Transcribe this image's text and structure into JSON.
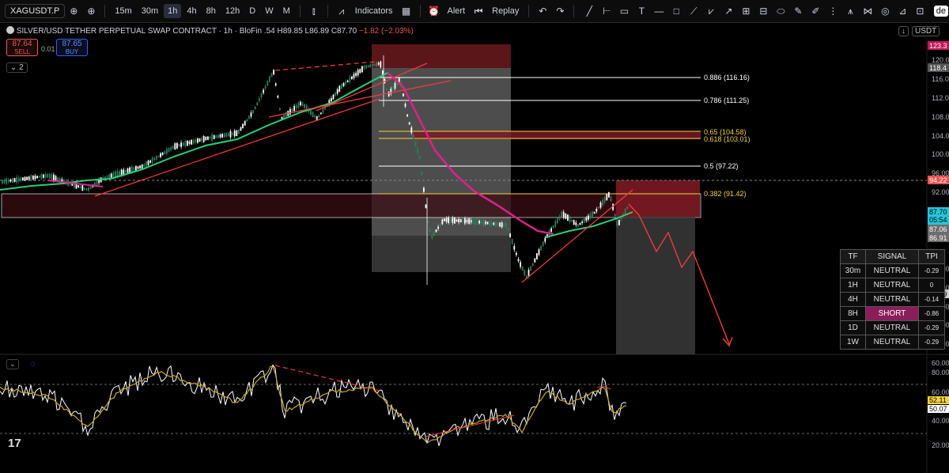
{
  "toolbar": {
    "symbol": "XAGUSDT.P",
    "timeframes": [
      "15m",
      "30m",
      "1h",
      "4h",
      "8h",
      "12h",
      "D",
      "W",
      "M"
    ],
    "active_timeframe": "1h",
    "indicators_label": "Indicators",
    "alert_label": "Alert",
    "replay_label": "Replay",
    "right_label": "de"
  },
  "legend": {
    "title": "SILVER/USD TETHER PERPETUAL SWAP CONTRACT · 1h · BloFin",
    "ohlc": ".54  H89.85  L86.89  C87.70",
    "change": "−1.82 (−2.03%)"
  },
  "trade": {
    "bid": "87.64",
    "bid_label": "SELL",
    "ask": "87.65",
    "ask_label": "BUY",
    "spread": "0.01",
    "collapsed_count": "2"
  },
  "top_right": {
    "currency": "USDT"
  },
  "price_axis": {
    "ticks": [
      "120.00",
      "116.00",
      "112.00",
      "108.00",
      "104.00",
      "100.00",
      "96.00",
      "92.00",
      "80.00",
      "76.00",
      "72.00",
      "68.00",
      "64.00",
      "60.00"
    ],
    "labels": [
      {
        "text": "123.3",
        "color": "#c2185b"
      },
      {
        "text": "118.4",
        "color": "#555555"
      },
      {
        "text": "94.22",
        "color": "#ef5350"
      },
      {
        "text": "87.70",
        "color": "#26c6da"
      },
      {
        "text": "05:54",
        "color": "#26c6da"
      },
      {
        "text": "87.06",
        "color": "#6d6d6d"
      },
      {
        "text": "86.91",
        "color": "#6d6d6d"
      },
      {
        "text": "74.59",
        "color": "#1e1e1e"
      }
    ]
  },
  "fib_levels": [
    {
      "label": "0.886 (116.16)",
      "color": "#ffffff"
    },
    {
      "label": "0.786 (111.25)",
      "color": "#ffffff"
    },
    {
      "label": "0.65 (104.58)",
      "color": "#f5d142"
    },
    {
      "label": "0.618 (103.01)",
      "color": "#f5d142"
    },
    {
      "label": "0.5 (97.22)",
      "color": "#ffffff"
    },
    {
      "label": "0.382 (91.42)",
      "color": "#f5d142"
    }
  ],
  "tpi_table": {
    "headers": [
      "TF",
      "SIGNAL",
      "TPI"
    ],
    "rows": [
      [
        "30m",
        "NEUTRAL",
        "-0.29"
      ],
      [
        "1H",
        "NEUTRAL",
        "0"
      ],
      [
        "4H",
        "NEUTRAL",
        "-0.14"
      ],
      [
        "8H",
        "SHORT",
        "-0.86"
      ],
      [
        "1D",
        "NEUTRAL",
        "-0.29"
      ],
      [
        "1W",
        "NEUTRAL",
        "-0.29"
      ]
    ]
  },
  "oscillator": {
    "ticks": [
      "80.00",
      "60.00",
      "40.00",
      "20.00"
    ],
    "labels": [
      {
        "text": "52.11",
        "color": "#f5d142"
      },
      {
        "text": "50.07",
        "color": "#ffffff"
      }
    ]
  },
  "colors": {
    "up": "#ffffff",
    "down": "#2e7d5b",
    "ema_green": "#26d07c",
    "ema_magenta": "#e0218a",
    "trend_red": "#ef3b3b",
    "fib_yellow": "#f5d142"
  },
  "brand": "17"
}
